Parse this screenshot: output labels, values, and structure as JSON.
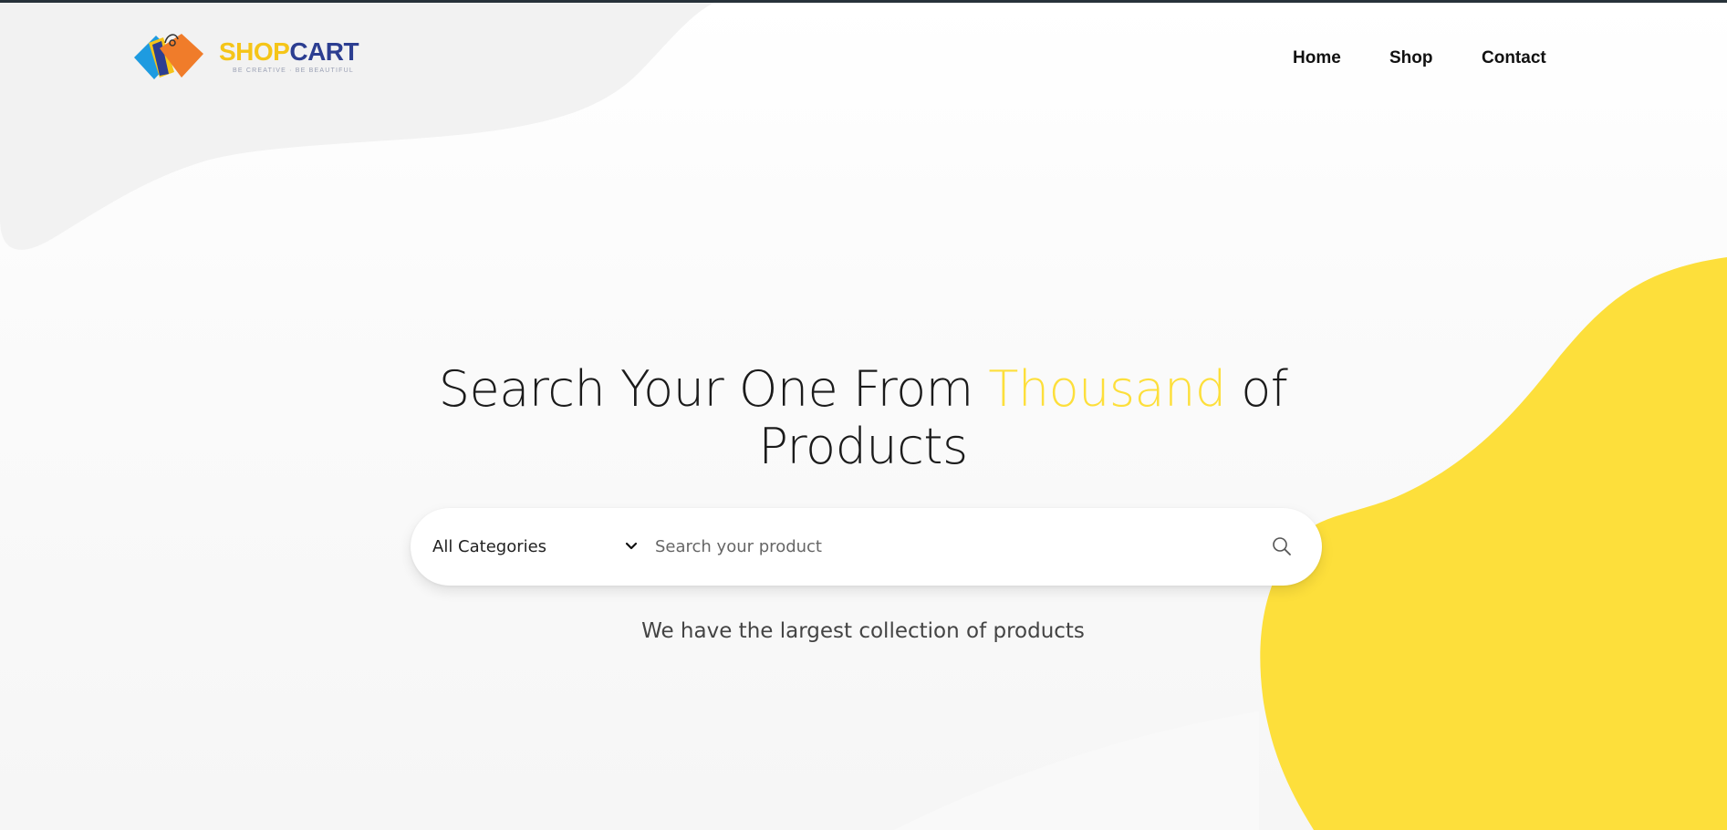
{
  "logo": {
    "word_shop": "SHOP",
    "word_cart": "CART",
    "tagline": "BE CREATIVE · BE BEAUTIFUL",
    "icon": "shopping-tags-icon",
    "colors": {
      "shop": "#f5c518",
      "cart": "#2c3e91",
      "tag_blue": "#1e9be0",
      "tag_orange": "#f07c2a",
      "tag_yellow": "#f5c518"
    }
  },
  "nav": {
    "items": [
      {
        "label": "Home"
      },
      {
        "label": "Shop"
      },
      {
        "label": "Contact"
      }
    ]
  },
  "hero": {
    "title_before": "Search Your One From ",
    "title_accent": "Thousand",
    "title_after": " of Products",
    "accent_color": "#fddf3b"
  },
  "search": {
    "category_selected": "All Categories",
    "placeholder": "Search your product",
    "value": "",
    "search_icon": "search-icon",
    "chevron_icon": "chevron-down-icon"
  },
  "subtitle": "We have the largest collection of products",
  "theme": {
    "background": "#f8f8f8",
    "blob_yellow": "#fddf3b",
    "blob_grey": "#f2f2f2",
    "top_rule": "#27323a"
  }
}
